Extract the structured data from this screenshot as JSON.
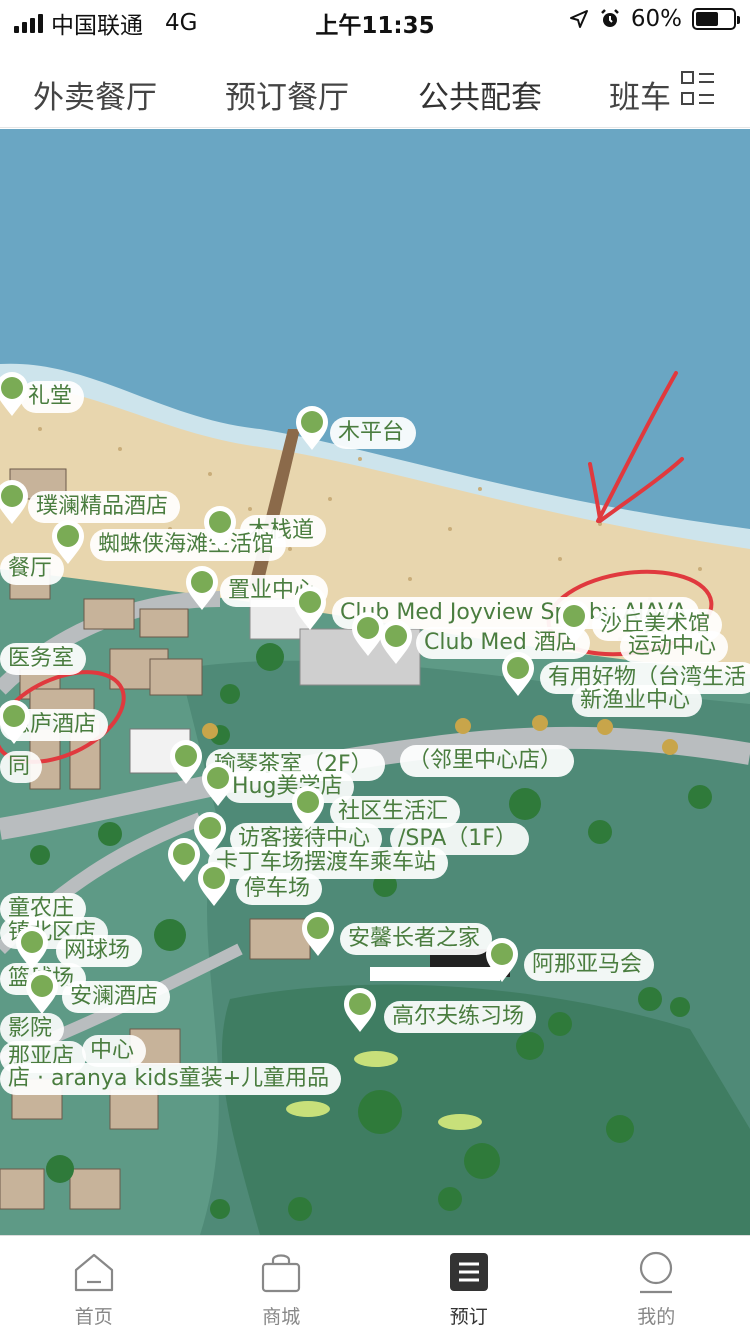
{
  "status_bar": {
    "carrier": "中国联通",
    "network": "4G",
    "time": "上午11:35",
    "battery_percent": "60%",
    "battery_level": 0.6
  },
  "tabs": [
    {
      "label": "外卖餐厅"
    },
    {
      "label": "预订餐厅"
    },
    {
      "label": "公共配套",
      "active": true
    },
    {
      "label": "班车"
    }
  ],
  "tabs_menu_icon": "grid-menu-icon",
  "map": {
    "pin_color": "#7aab55",
    "labels": [
      "礼堂",
      "木平台",
      "璞澜精品酒店",
      "木栈道",
      "蜘蛛侠海滩生活馆",
      "餐厅",
      "置业中心",
      "Club Med Joyview Spa by AIAVA",
      "Club Med 酒店",
      "沙丘美术馆",
      "运动中心",
      "医务室",
      "有用好物（台湾生活",
      "新渔业中心",
      "隐庐酒店",
      "（邻里中心店）",
      "瑜琴茶室（2F）",
      "Hug美学店",
      "社区生活汇",
      "访客接待中心",
      "/SPA（1F）",
      "卡丁车场摆渡车乘车站",
      "停车场",
      "童农庄",
      "镇北区店",
      "网球场",
      "安馨长者之家",
      "阿那亚马会",
      "篮球场",
      "安澜酒店",
      "高尔夫练习场",
      "影院",
      "那亚店",
      "中心",
      "店 · aranya kids童装+儿童用品",
      "同"
    ],
    "annotation": "red hand-drawn circles and arrow"
  },
  "bottom_nav": [
    {
      "label": "首页",
      "icon": "home-icon"
    },
    {
      "label": "商城",
      "icon": "shopping-bag-icon"
    },
    {
      "label": "预订",
      "icon": "booking-list-icon",
      "active": true
    },
    {
      "label": "我的",
      "icon": "profile-icon"
    }
  ]
}
